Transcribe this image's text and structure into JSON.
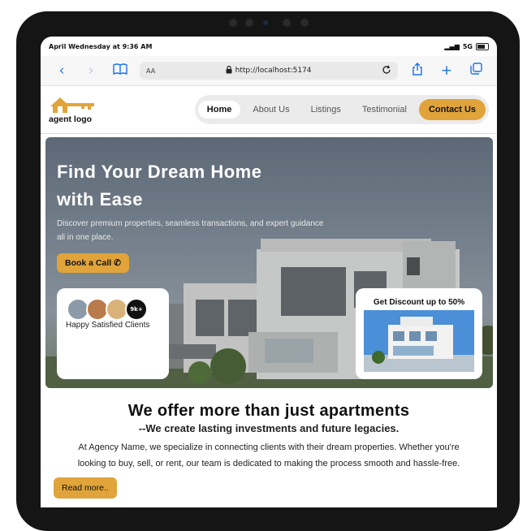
{
  "status": {
    "time": "April Wednesday at 9:36 AM",
    "network": "5G"
  },
  "browser": {
    "text_size_label": "AA",
    "url": "http://localhost:5174"
  },
  "nav": {
    "logo_text": "agent logo",
    "items": [
      {
        "label": "Home",
        "active": true
      },
      {
        "label": "About Us",
        "active": false
      },
      {
        "label": "Listings",
        "active": false
      },
      {
        "label": "Testimonial",
        "active": false
      }
    ],
    "contact_label": "Contact Us"
  },
  "hero": {
    "title_line1": "Find Your Dream Home",
    "title_line2": "with Ease",
    "subtitle_line1": "Discover premium properties, seamless transactions, and expert guidance",
    "subtitle_line2": "all in one place.",
    "book_label": "Book a Call",
    "clients_badge": "9k+",
    "clients_caption": "Happy Satisfied Clients",
    "discount_caption": "Get Discount up to 50%"
  },
  "about": {
    "heading": "We offer more than just apartments",
    "subheading": "--We create lasting investments and future legacies.",
    "body_line1": "At Agency Name, we specialize in connecting clients with their dream properties. Whether you're",
    "body_line2": "looking to buy, sell, or rent, our team is dedicated to making the process smooth and hassle-free.",
    "read_more_label": "Read more.."
  },
  "colors": {
    "accent": "#e0a43a",
    "device": "#151515",
    "link_blue": "#1a73e8"
  }
}
